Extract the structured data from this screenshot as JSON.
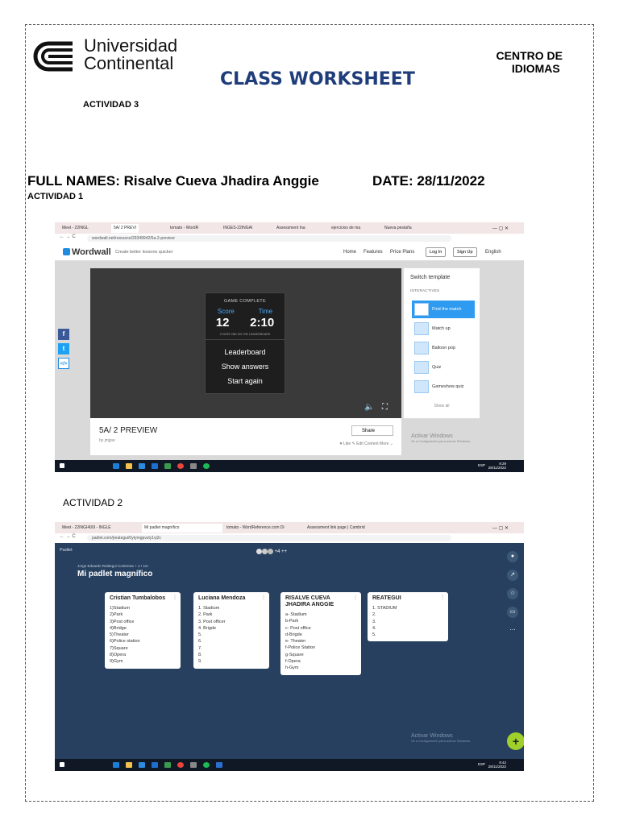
{
  "header": {
    "logo_line1": "Universidad",
    "logo_line2": "Continental",
    "centro_line1": "CENTRO DE",
    "centro_line2": "IDIOMAS",
    "title": "CLASS WORKSHEET",
    "actividad3": "ACTIVIDAD 3",
    "full_names": "FULL NAMES: Risalve Cueva Jhadira Anggie",
    "date": "DATE: 28/11/2022",
    "actividad1": "ACTIVIDAD 1",
    "actividad2": "ACTIVIDAD 2"
  },
  "shot1": {
    "tabs": [
      "Meet - 22INGL",
      "5A/ 2 PREVI",
      "tomato - WordR",
      "INGES-22INGAI",
      "Assessment Ina",
      "ejercicios de ma",
      "Nueva pestaña"
    ],
    "url": "wordwall.net/resource/29349942/5a-2-preview",
    "brand": "Wordwall",
    "tagline": "Create better lessons quicker",
    "nav": [
      "Home",
      "Features",
      "Price Plans"
    ],
    "login": "Log In",
    "signup": "Sign Up",
    "lang": "English",
    "game": {
      "status": "GAME COMPLETE",
      "score_label": "Score",
      "time_label": "Time",
      "score": "12",
      "time": "2:10",
      "rank": "YOU'RE 2ND ON THE LEADERBOARD",
      "menu": [
        "Leaderboard",
        "Show answers",
        "Start again"
      ]
    },
    "activity_title": "5A/ 2 PREVIEW",
    "by": "by jmjpw",
    "share": "Share",
    "actions": "♥ Like   ✎ Edit Content   More ⌄",
    "sidebar": {
      "title": "Switch template",
      "subtitle": "INTERACTIVES",
      "templates": [
        "Find the match",
        "Match up",
        "Balloon pop",
        "Quiz",
        "Gameshow quiz"
      ],
      "more": "Show all"
    },
    "activar": "Activar Windows",
    "activar_sub": "Ve a Configuración para activar Windows.",
    "clock_time": "9:29",
    "clock_date": "28/11/2022",
    "lang_code": "ESP"
  },
  "shot2": {
    "tabs": [
      "Meet - 22INGI400I - INGLE",
      "Mi padlet magnífico",
      "tomato - WordReference.com Di",
      "Assessment link page | Cambrid"
    ],
    "url": "padlet.com/jreategui/0ytymgpvzty1vj2c",
    "brand": "Padlet",
    "avatars": "+4 ++",
    "by": "Jorge Eduardo Reátegui Contreras + 1 • 1m",
    "title": "Mi padlet magnífico",
    "cards": [
      {
        "title": "Cristian Tumbalobos",
        "items": [
          "1)Stadium",
          "2)Park",
          "3)Post office",
          "4)Bridge",
          "5)Theater",
          "6)Police station",
          "7)Square",
          "8)Opera",
          "9)Gym"
        ]
      },
      {
        "title": "Luciana Mendoza",
        "items": [
          "1. Stadium",
          "2. Park",
          "3. Post officer",
          "4. Brigde",
          "5.",
          "6.",
          "7.",
          "8.",
          "9."
        ]
      },
      {
        "title": "RISALVE CUEVA JHADIRA ANGGIE",
        "items": [
          "a- Stadium",
          "b-Park",
          "c- Post office",
          "d-Brigde",
          "e- Theater",
          "f-Police Station",
          "g-Square",
          "f-Opera",
          "h-Gym"
        ]
      },
      {
        "title": "REATEGUI",
        "items": [
          "1. STADIUM",
          "2.",
          "3.",
          "4.",
          "5."
        ]
      }
    ],
    "activar": "Activar Windows",
    "activar_sub": "Ve a Configuración para activar Windows.",
    "clock_time": "9:42",
    "clock_date": "28/11/2022",
    "lang_code": "ESP"
  }
}
